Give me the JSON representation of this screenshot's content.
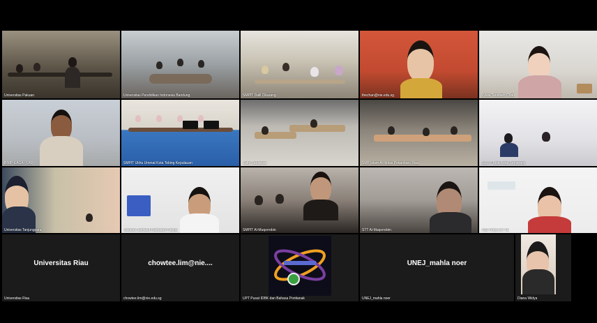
{
  "tiles": {
    "r1c1": "Universitas Pakuan",
    "r1c2": "Universitas Pendidikan Indonesia Bandung",
    "r1c3": "SMPIT Dalil Cikarang",
    "r1c4": "thechan@nie.edu.sg",
    "r1c5": "Sylvia Tandiseh Chan",
    "r2c1": "BIMP-EAGA - UKI",
    "r2c2": "SMPIT Ukhu Ummat Kota Tebing Kepulauan",
    "r2c3": "Yatty Satriapasi",
    "r2c4": "SMP Islam Al-Ikhlas Pekanbaru Riau",
    "r2c5": "SMPIT Bina Amal Semarang",
    "r3c1": "Universitas Tanjungpura",
    "r3c2": "Sekolah Jamiatul Hamasah Panipa",
    "r3c3": "SMPIT Al-Muqorrobin",
    "r3c4": "STT Al-Muqorrobin",
    "r3c5": "TSU Teng Lee Tai",
    "r4c1": "Universitas Riau",
    "r4c2": "chowtee.lim@nie.edu.sg",
    "r4c3": "UPT Pusat IDBK dan Bahasa Pontianak",
    "r4c4": "UNEJ_mahla noer",
    "r4c5": "Diana Widya"
  },
  "labels": {
    "riau": "Universitas Riau",
    "chowtee": "chowtee.lim@nie....",
    "unej": "UNEJ_mahla noer"
  },
  "colors": {
    "background": "#000000",
    "tile_bg": "#1b1b1b",
    "logo_orange": "#f0a020",
    "logo_purple": "#7a3fa0"
  }
}
